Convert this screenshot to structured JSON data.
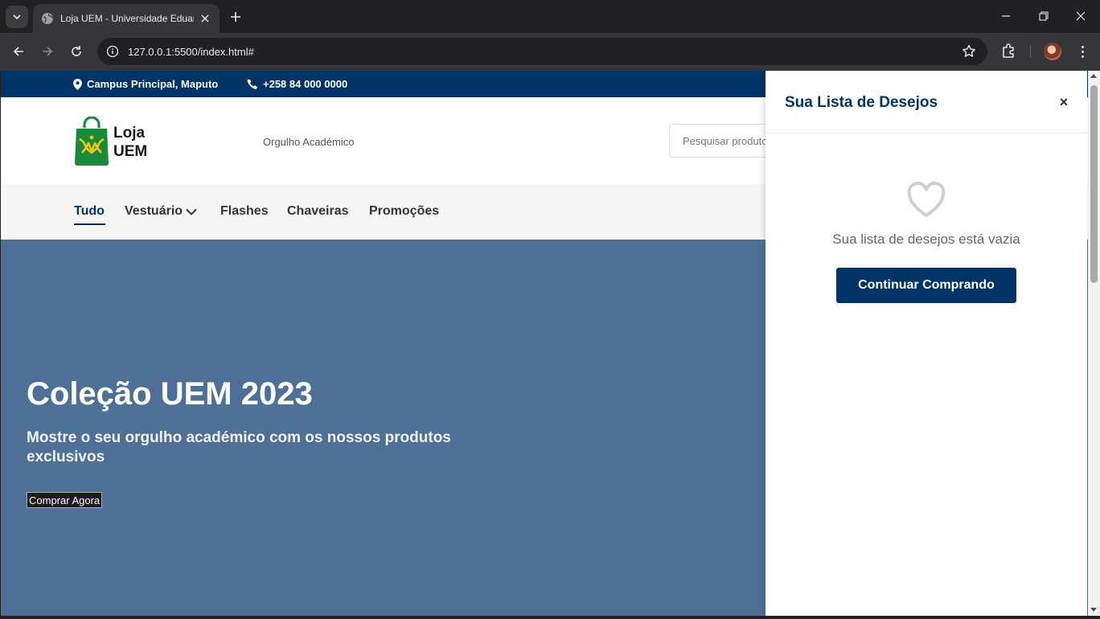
{
  "browser": {
    "tab_title": "Loja UEM - Universidade Eduardo Mondlane",
    "url": "127.0.0.1:5500/index.html#"
  },
  "topbar": {
    "location": "Campus Principal, Maputo",
    "phone": "+258 84 000 0000"
  },
  "header": {
    "logo_line1": "Loja",
    "logo_line2": "UEM",
    "tagline": "Orgulho Académico",
    "search_placeholder": "Pesquisar produtos..."
  },
  "nav": {
    "items": [
      {
        "label": "Tudo",
        "active": true
      },
      {
        "label": "Vestuário",
        "dropdown": true
      },
      {
        "label": "Flashes"
      },
      {
        "label": "Chaveiras"
      },
      {
        "label": "Promoções"
      }
    ]
  },
  "hero": {
    "title": "Coleção UEM 2023",
    "subtitle": "Mostre o seu orgulho académico com os nossos produtos exclusivos",
    "button": "Comprar Agora"
  },
  "wishlist": {
    "title": "Sua Lista de Desejos",
    "close": "×",
    "empty_message": "Sua lista de desejos está vazia",
    "continue_button": "Continuar Comprando"
  },
  "colors": {
    "brand_navy": "#003366",
    "hero_bg": "#4e7096",
    "logo_green": "#1b8a3c",
    "logo_yellow": "#f5c518"
  },
  "icons": {
    "location": "map-pin-icon",
    "phone": "phone-icon",
    "wishlist_empty": "heart-outline-icon"
  }
}
